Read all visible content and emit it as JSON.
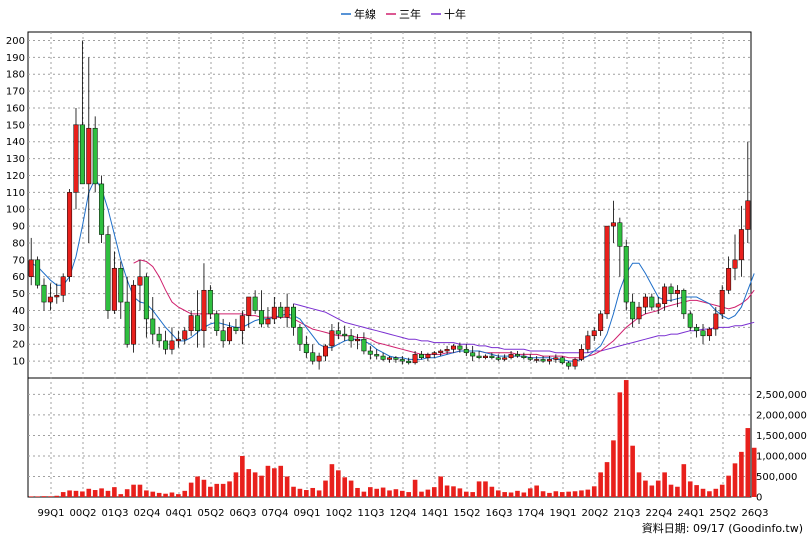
{
  "legend": [
    {
      "label": "年線",
      "color": "#1f6fc9"
    },
    {
      "label": "三年",
      "color": "#d0206e"
    },
    {
      "label": "十年",
      "color": "#7a2fd1"
    }
  ],
  "footer": "資料日期: 09/17   (Goodinfo.tw)",
  "chart_data": {
    "type": "candlestick",
    "candle_up_color": "#e8201c",
    "candle_down_color": "#2fbf3f",
    "volume_color": "#e8201c",
    "price_axis": {
      "ticks": [
        "10",
        "20",
        "30",
        "40",
        "50",
        "60",
        "70",
        "80",
        "90",
        "100",
        "110",
        "120",
        "130",
        "140",
        "150",
        "160",
        "170",
        "180",
        "190",
        "200"
      ],
      "ylim": [
        0,
        205
      ]
    },
    "volume_axis": {
      "ticks": [
        "0",
        "500,000",
        "1,000,000",
        "1,500,000",
        "2,000,000",
        "2,500,000"
      ],
      "ylim": [
        0,
        2900000
      ]
    },
    "x_ticks": [
      "99Q1",
      "00Q2",
      "01Q3",
      "02Q4",
      "04Q1",
      "05Q2",
      "06Q3",
      "07Q4",
      "09Q1",
      "10Q2",
      "11Q3",
      "12Q4",
      "14Q1",
      "15Q2",
      "16Q3",
      "17Q4",
      "19Q1",
      "20Q2",
      "21Q3",
      "22Q4",
      "24Q1",
      "25Q2",
      "26Q3"
    ],
    "ohlc": [
      [
        60,
        83,
        55,
        70
      ],
      [
        70,
        72,
        53,
        55
      ],
      [
        55,
        59,
        40,
        45
      ],
      [
        45,
        56,
        40,
        48
      ],
      [
        48,
        56,
        44,
        49
      ],
      [
        49,
        62,
        45,
        60
      ],
      [
        60,
        112,
        57,
        110
      ],
      [
        110,
        160,
        100,
        150
      ],
      [
        150,
        200,
        120,
        115
      ],
      [
        115,
        190,
        80,
        148
      ],
      [
        148,
        155,
        110,
        115
      ],
      [
        115,
        120,
        80,
        85
      ],
      [
        85,
        90,
        35,
        40
      ],
      [
        40,
        75,
        38,
        65
      ],
      [
        65,
        69,
        35,
        45
      ],
      [
        45,
        60,
        18,
        20
      ],
      [
        20,
        58,
        15,
        55
      ],
      [
        55,
        70,
        40,
        60
      ],
      [
        60,
        62,
        24,
        35
      ],
      [
        35,
        48,
        20,
        26
      ],
      [
        26,
        30,
        18,
        22
      ],
      [
        22,
        28,
        14,
        17
      ],
      [
        17,
        30,
        14,
        22
      ],
      [
        22,
        28,
        18,
        23
      ],
      [
        23,
        30,
        20,
        28
      ],
      [
        28,
        40,
        25,
        37
      ],
      [
        37,
        52,
        18,
        28
      ],
      [
        28,
        68,
        18,
        52
      ],
      [
        52,
        55,
        35,
        38
      ],
      [
        38,
        40,
        25,
        28
      ],
      [
        28,
        35,
        18,
        22
      ],
      [
        22,
        33,
        20,
        30
      ],
      [
        30,
        35,
        26,
        28
      ],
      [
        28,
        40,
        20,
        37
      ],
      [
        37,
        45,
        30,
        48
      ],
      [
        48,
        52,
        38,
        40
      ],
      [
        40,
        52,
        30,
        32
      ],
      [
        32,
        42,
        30,
        35
      ],
      [
        35,
        48,
        32,
        42
      ],
      [
        42,
        45,
        35,
        36
      ],
      [
        36,
        50,
        30,
        42
      ],
      [
        42,
        44,
        25,
        30
      ],
      [
        30,
        32,
        16,
        20
      ],
      [
        20,
        25,
        12,
        15
      ],
      [
        15,
        20,
        8,
        10
      ],
      [
        10,
        15,
        5,
        13
      ],
      [
        13,
        20,
        10,
        19
      ],
      [
        19,
        32,
        16,
        28
      ],
      [
        28,
        33,
        23,
        26
      ],
      [
        26,
        31,
        22,
        25
      ],
      [
        25,
        29,
        18,
        22
      ],
      [
        22,
        26,
        17,
        23
      ],
      [
        23,
        27,
        14,
        16
      ],
      [
        16,
        19,
        11,
        14
      ],
      [
        14,
        17,
        11,
        13
      ],
      [
        13,
        15,
        10,
        11
      ],
      [
        11,
        13,
        9,
        12
      ],
      [
        12,
        13,
        9,
        11
      ],
      [
        11,
        13,
        8,
        10
      ],
      [
        10,
        12,
        8,
        9
      ],
      [
        9,
        16,
        8,
        14
      ],
      [
        14,
        16,
        11,
        12
      ],
      [
        12,
        15,
        10,
        14
      ],
      [
        14,
        16,
        12,
        15
      ],
      [
        15,
        17,
        13,
        16
      ],
      [
        16,
        19,
        14,
        17
      ],
      [
        17,
        20,
        15,
        19
      ],
      [
        19,
        21,
        15,
        17
      ],
      [
        17,
        20,
        13,
        15
      ],
      [
        15,
        19,
        10,
        13
      ],
      [
        13,
        16,
        11,
        12
      ],
      [
        12,
        14,
        11,
        13
      ],
      [
        13,
        15,
        11,
        12
      ],
      [
        12,
        14,
        10,
        11
      ],
      [
        11,
        14,
        10,
        12
      ],
      [
        12,
        16,
        11,
        14
      ],
      [
        14,
        16,
        12,
        13
      ],
      [
        13,
        15,
        11,
        12
      ],
      [
        12,
        14,
        10,
        11
      ],
      [
        11,
        13,
        9,
        11
      ],
      [
        11,
        13,
        9,
        10
      ],
      [
        10,
        13,
        8,
        11
      ],
      [
        11,
        14,
        9,
        12
      ],
      [
        12,
        13,
        8,
        9
      ],
      [
        9,
        10,
        5,
        7
      ],
      [
        7,
        12,
        5,
        11
      ],
      [
        11,
        20,
        10,
        17
      ],
      [
        17,
        28,
        15,
        25
      ],
      [
        25,
        30,
        22,
        28
      ],
      [
        28,
        40,
        25,
        38
      ],
      [
        38,
        80,
        35,
        90
      ],
      [
        90,
        105,
        80,
        92
      ],
      [
        92,
        95,
        60,
        78
      ],
      [
        78,
        82,
        40,
        45
      ],
      [
        45,
        50,
        30,
        35
      ],
      [
        35,
        45,
        32,
        42
      ],
      [
        42,
        50,
        38,
        48
      ],
      [
        48,
        50,
        40,
        42
      ],
      [
        42,
        48,
        38,
        44
      ],
      [
        44,
        56,
        40,
        54
      ],
      [
        54,
        56,
        45,
        50
      ],
      [
        50,
        55,
        42,
        52
      ],
      [
        52,
        53,
        35,
        38
      ],
      [
        38,
        40,
        28,
        30
      ],
      [
        30,
        32,
        24,
        28
      ],
      [
        28,
        32,
        20,
        25
      ],
      [
        25,
        30,
        22,
        29
      ],
      [
        29,
        42,
        25,
        38
      ],
      [
        38,
        55,
        35,
        52
      ],
      [
        52,
        72,
        50,
        65
      ],
      [
        65,
        85,
        58,
        70
      ],
      [
        70,
        102,
        60,
        88
      ],
      [
        88,
        140,
        80,
        105
      ]
    ],
    "volume": [
      15000,
      15000,
      20000,
      18000,
      30000,
      120000,
      160000,
      150000,
      135000,
      200000,
      170000,
      210000,
      150000,
      240000,
      70000,
      190000,
      300000,
      300000,
      160000,
      130000,
      100000,
      80000,
      110000,
      70000,
      150000,
      350000,
      500000,
      420000,
      250000,
      320000,
      320000,
      380000,
      600000,
      1000000,
      680000,
      600000,
      520000,
      760000,
      700000,
      760000,
      500000,
      250000,
      200000,
      170000,
      220000,
      160000,
      400000,
      800000,
      650000,
      480000,
      400000,
      220000,
      130000,
      240000,
      200000,
      230000,
      160000,
      190000,
      150000,
      120000,
      420000,
      130000,
      180000,
      240000,
      500000,
      280000,
      260000,
      210000,
      130000,
      120000,
      380000,
      380000,
      250000,
      160000,
      120000,
      110000,
      150000,
      110000,
      210000,
      280000,
      140000,
      100000,
      140000,
      120000,
      130000,
      140000,
      160000,
      180000,
      260000,
      600000,
      850000,
      1380000,
      2550000,
      2850000,
      1250000,
      600000,
      400000,
      280000,
      400000,
      600000,
      300000,
      250000,
      800000,
      380000,
      290000,
      200000,
      140000,
      200000,
      300000,
      520000,
      820000,
      1100000,
      1680000,
      1200000
    ],
    "ma_year": [
      68,
      66,
      62,
      58,
      55,
      55,
      60,
      72,
      90,
      110,
      118,
      112,
      100,
      85,
      70,
      58,
      48,
      45,
      44,
      40,
      35,
      30,
      26,
      22,
      22,
      24,
      27,
      30,
      32,
      33,
      32,
      31,
      30,
      30,
      32,
      34,
      35,
      35,
      36,
      37,
      38,
      37,
      35,
      30,
      25,
      20,
      18,
      18,
      20,
      22,
      23,
      23,
      22,
      20,
      17,
      15,
      13,
      12,
      12,
      11,
      11,
      11,
      12,
      12,
      13,
      14,
      15,
      16,
      16,
      16,
      16,
      15,
      14,
      13,
      13,
      13,
      13,
      13,
      12,
      12,
      12,
      12,
      11,
      11,
      10,
      10,
      11,
      13,
      16,
      19,
      26,
      38,
      52,
      62,
      68,
      68,
      62,
      55,
      48,
      46,
      46,
      47,
      48,
      48,
      48,
      46,
      44,
      40,
      37,
      35,
      37,
      42,
      52,
      62
    ],
    "ma_3y": [
      null,
      null,
      null,
      null,
      null,
      null,
      null,
      null,
      null,
      null,
      null,
      null,
      null,
      null,
      null,
      null,
      68,
      70,
      69,
      66,
      60,
      52,
      45,
      42,
      40,
      38,
      38,
      38,
      38,
      38,
      38,
      38,
      38,
      38,
      37,
      37,
      36,
      36,
      36,
      36,
      36,
      35,
      33,
      31,
      29,
      28,
      27,
      26,
      25,
      25,
      25,
      24,
      24,
      23,
      21,
      20,
      19,
      18,
      17,
      16,
      15,
      14,
      14,
      14,
      14,
      15,
      15,
      16,
      16,
      16,
      16,
      15,
      15,
      15,
      15,
      15,
      14,
      14,
      14,
      14,
      13,
      13,
      13,
      13,
      12,
      12,
      12,
      13,
      14,
      16,
      19,
      22,
      26,
      30,
      33,
      36,
      38,
      39,
      40,
      42,
      43,
      44,
      45,
      46,
      46,
      45,
      44,
      43,
      42,
      41,
      42,
      44,
      47,
      52
    ],
    "ma_10y": [
      null,
      null,
      null,
      null,
      null,
      null,
      null,
      null,
      null,
      null,
      null,
      null,
      null,
      null,
      null,
      null,
      null,
      null,
      null,
      null,
      null,
      null,
      null,
      null,
      null,
      null,
      null,
      null,
      null,
      null,
      null,
      null,
      null,
      null,
      null,
      null,
      null,
      null,
      null,
      null,
      null,
      44,
      43,
      42,
      41,
      40,
      39,
      37,
      35,
      33,
      32,
      31,
      30,
      29,
      28,
      27,
      26,
      25,
      24,
      23,
      23,
      22,
      22,
      21,
      21,
      21,
      21,
      20,
      20,
      20,
      19,
      19,
      18,
      18,
      17,
      17,
      17,
      17,
      16,
      16,
      16,
      16,
      15,
      15,
      15,
      15,
      15,
      15,
      16,
      16,
      17,
      18,
      19,
      20,
      21,
      22,
      23,
      24,
      25,
      25,
      26,
      26,
      27,
      28,
      28,
      29,
      29,
      30,
      30,
      30,
      31,
      31,
      32,
      33
    ]
  }
}
